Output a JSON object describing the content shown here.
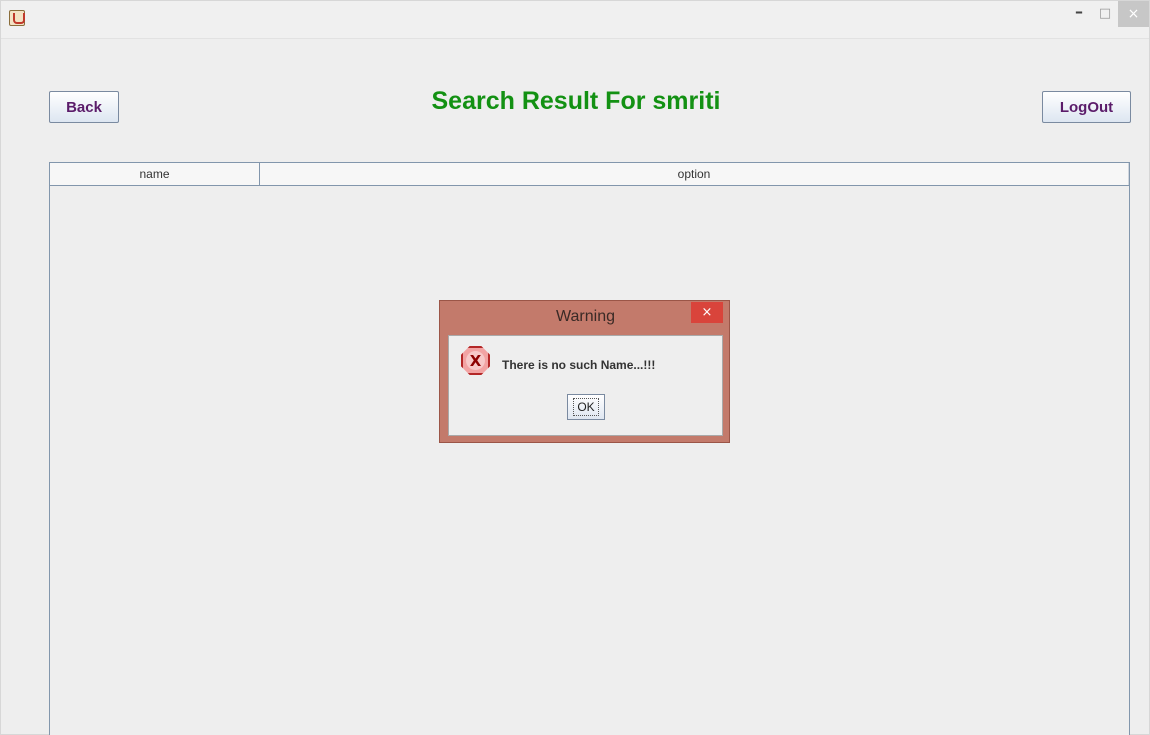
{
  "window": {
    "icon": "java-app-icon",
    "controls": {
      "minimize": "–",
      "maximize": "□",
      "close": "×"
    }
  },
  "header": {
    "back_label": "Back",
    "title": "Search Result For smriti",
    "logout_label": "LogOut"
  },
  "table": {
    "columns": [
      "name",
      "option"
    ],
    "rows": []
  },
  "dialog": {
    "title": "Warning",
    "close": "×",
    "icon": "error-icon",
    "icon_glyph": "X",
    "message": "There is no such Name...!!!",
    "ok_label": "OK"
  },
  "colors": {
    "title": "#139113",
    "button_text": "#5b1c6a",
    "dialog_frame": "#c37a6b",
    "dialog_close": "#d9443b"
  }
}
